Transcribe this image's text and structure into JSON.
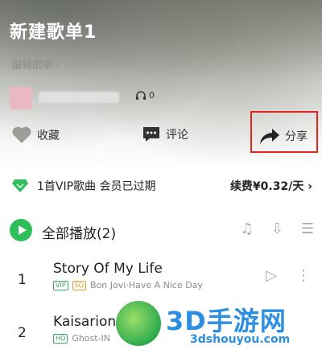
{
  "header": {
    "title": "新建歌单1",
    "edit_label": "编辑歌单",
    "play_count": "0"
  },
  "actions": {
    "favorite_label": "收藏",
    "comment_label": "评论",
    "share_label": "分享"
  },
  "vip": {
    "status_text": "1首VIP歌曲 会员已过期",
    "renew_text": "续费¥0.32/天"
  },
  "playall": {
    "label": "全部播放(2)"
  },
  "songs": [
    {
      "index": "1",
      "title": "Story Of My Life",
      "tags": [
        "VIP",
        "SQ"
      ],
      "meta": "Bon Jovi·Have A Nice Day"
    },
    {
      "index": "2",
      "title": "Kaisarion",
      "tags": [
        "HQ"
      ],
      "meta": "Ghost-IN"
    }
  ],
  "watermark": {
    "brand": "3D手游网",
    "url": "3dshouyou.com"
  },
  "colors": {
    "accent_green": "#2fbf5a",
    "highlight_red": "#e2261b",
    "watermark_blue": "#2d8fe0"
  }
}
